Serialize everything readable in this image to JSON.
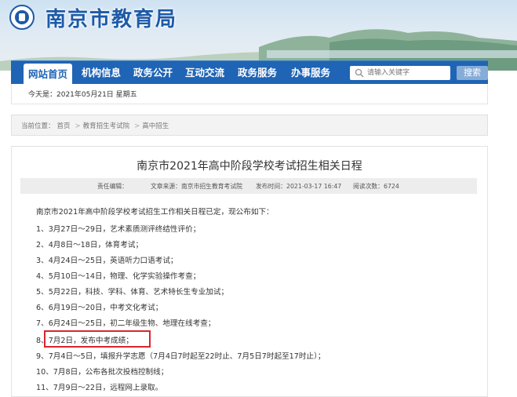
{
  "header": {
    "site_title": "南京市教育局",
    "logo_icon": "nanjing-emblem-icon"
  },
  "nav": {
    "items": [
      {
        "label": "网站首页",
        "active": true
      },
      {
        "label": "机构信息",
        "active": false
      },
      {
        "label": "政务公开",
        "active": false
      },
      {
        "label": "互动交流",
        "active": false
      },
      {
        "label": "政务服务",
        "active": false
      },
      {
        "label": "办事服务",
        "active": false
      }
    ],
    "search_placeholder": "请输入关键字",
    "search_button": "搜索",
    "search_icon": "search-icon"
  },
  "datebar": {
    "today": "今天是：2021年05月21日  星期五"
  },
  "breadcrumb": {
    "prefix": "当前位置：",
    "items": [
      "首页",
      "教育招生考试院",
      "高中招生"
    ],
    "separator": ">"
  },
  "article": {
    "title": "南京市2021年高中阶段学校考试招生相关日程",
    "meta": {
      "editor": "责任编辑：",
      "source": "文章来源：南京市招生教育考试院",
      "time": "发布时间：2021-03-17 16:47",
      "reads": "阅读次数：6724"
    },
    "lines": [
      "南京市2021年高中阶段学校考试招生工作相关日程已定，现公布如下：",
      "1、3月27日～29日，艺术素质测评终结性评价；",
      "2、4月8日～18日，体育考试；",
      "3、4月24日～25日，英语听力口语考试；",
      "4、5月10日～14日，物理、化学实验操作考查；",
      "5、5月22日，科技、学科、体育、艺术特长生专业加试；",
      "6、6月19日～20日，中考文化考试；",
      "7、6月24日～25日，初二年级生物、地理在线考查；",
      "8、7月2日，发布中考成绩；",
      "9、7月4日～5日，填报升学志愿（7月4日7时起至22时止、7月5日7时起至17时止）；",
      "10、7月8日，公布各批次投档控制线；",
      "11、7月9日～22日，远程网上录取。"
    ]
  },
  "colors": {
    "brand_blue": "#1f64b5",
    "highlight_red": "#d8262e"
  }
}
